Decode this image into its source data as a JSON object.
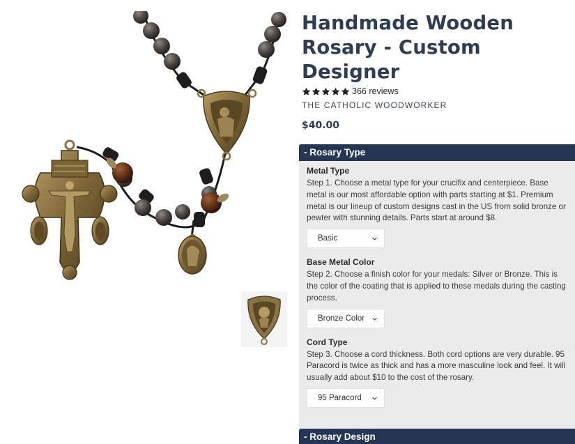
{
  "product": {
    "title": "Handmade Wooden Rosary - Custom Designer",
    "rating_stars": 5,
    "reviews": "366 reviews",
    "vendor": "THE CATHOLIC WOODWORKER",
    "price": "$40.00"
  },
  "options_panel": {
    "header": "- Rosary Type",
    "groups": [
      {
        "label": "Metal Type",
        "description": "Step 1. Choose a metal type for your crucifix and centerpiece. Base metal is our most affordable option with parts starting at $1. Premium metal is our lineup of custom designs cast in the US from solid bronze or pewter with stunning details. Parts start at around $8.",
        "selected": "Basic"
      },
      {
        "label": "Base Metal Color",
        "description": "Step 2. Choose a finish color for your medals: Silver or Bronze. This is the color of the coating that is applied to these medals during the casting process.",
        "selected": "Bronze Color"
      },
      {
        "label": "Cord Type",
        "description": "Step 3. Choose a cord thickness. Both cord options are very durable. 95 Paracord is twice as thick and has a more masculine look and feel. It will usually add about $10 to the cost of the rosary.",
        "selected": "95 Paracord"
      }
    ],
    "next_header": "- Rosary Design"
  },
  "colors": {
    "title": "#2f3d52",
    "panel_header": "#253655",
    "panel_bg": "#ebebeb",
    "bronze": "#8a7446",
    "wood_bead": "#6b3d22",
    "grey_bead": "#4a4542"
  },
  "icons": {
    "star": "star-icon",
    "select_arrow": "chevron-down-icon"
  }
}
